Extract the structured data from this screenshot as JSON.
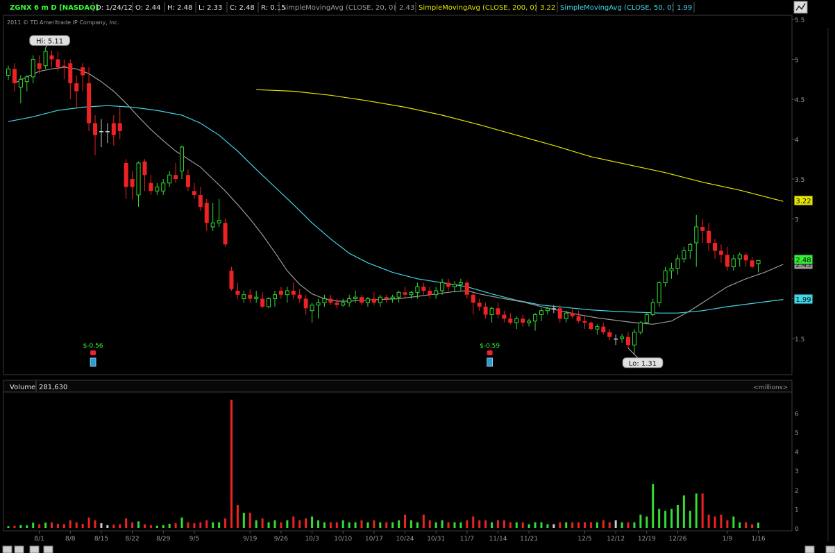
{
  "header": {
    "symbol": "ZGNX 6 m D [NASDAQ]",
    "d_label": "D: 1/24/12",
    "o_label": "O: 2.44",
    "h_label": "H: 2.48",
    "l_label": "L: 2.33",
    "c_label": "C: 2.48",
    "r_label": "R: 0.15",
    "studies": [
      {
        "label": "SimpleMovingAvg (CLOSE, 20, 0)",
        "value": "2.43",
        "color": "#9a9a9a"
      },
      {
        "label": "SimpleMovingAvg (CLOSE, 200, 0)",
        "value": "3.22",
        "color": "#e6e600"
      },
      {
        "label": "SimpleMovingAvg (CLOSE, 50, 0)",
        "value": "1.99",
        "color": "#40d8e8"
      }
    ]
  },
  "copyright": "2011 © TD Ameritrade IP Company, Inc.",
  "volume_panel": {
    "label": "Volume",
    "value": "281,630",
    "units": "<millions>"
  },
  "annotations": {
    "hi": "Hi: 5.11",
    "lo": "Lo: 1.31",
    "dividends": [
      "$-0.56",
      "$-0.59"
    ]
  },
  "price_badges": {
    "sma200": "3.22",
    "last": "2.48",
    "sma50": "1.99",
    "hidden": "2.43"
  },
  "colors": {
    "up": "#33dd33",
    "down": "#ee2222",
    "unchanged": "#cccccc",
    "sma20": "#9a9a9a",
    "sma200": "#e6e600",
    "sma50": "#40d8e8",
    "label_green": "#33ff33",
    "frame": "#3a3a3a"
  },
  "chart_data": {
    "type": "candlestick",
    "price_ylim": [
      1.0,
      5.5
    ],
    "price_ticks": [
      "5.5",
      "5",
      "4.5",
      "4",
      "3.5",
      "3",
      "2.5",
      "2",
      "1.5"
    ],
    "volume_ylim": [
      0,
      7
    ],
    "volume_ticks": [
      "6",
      "5",
      "4",
      "3",
      "2",
      "1",
      "0"
    ],
    "x_tick_labels": [
      "8/1",
      "8/8",
      "8/15",
      "8/22",
      "8/29",
      "9/5",
      "9/19",
      "9/26",
      "10/3",
      "10/10",
      "10/17",
      "10/24",
      "10/31",
      "11/7",
      "11/14",
      "11/21",
      "12/5",
      "12/12",
      "12/19",
      "12/26",
      "1/9",
      "1/16"
    ],
    "x_tick_index": [
      5,
      10,
      15,
      20,
      25,
      30,
      39,
      44,
      49,
      54,
      59,
      64,
      69,
      74,
      79,
      84,
      93,
      98,
      103,
      108,
      116,
      121
    ],
    "candles": [
      [
        4.8,
        4.92,
        4.74,
        4.88,
        0.1
      ],
      [
        4.88,
        4.95,
        4.6,
        4.7,
        0.12
      ],
      [
        4.65,
        4.8,
        4.45,
        4.75,
        0.15
      ],
      [
        4.72,
        4.8,
        4.6,
        4.78,
        0.14
      ],
      [
        4.78,
        5.05,
        4.7,
        5.0,
        0.28
      ],
      [
        4.95,
        5.05,
        4.82,
        4.88,
        0.2
      ],
      [
        4.92,
        5.14,
        4.88,
        5.1,
        0.28
      ],
      [
        5.05,
        5.11,
        4.9,
        5.0,
        0.3
      ],
      [
        5.0,
        5.1,
        4.85,
        4.9,
        0.22
      ],
      [
        4.92,
        5.0,
        4.75,
        4.9,
        0.2
      ],
      [
        4.95,
        5.0,
        4.5,
        4.7,
        0.4
      ],
      [
        4.7,
        4.8,
        4.4,
        4.6,
        0.3
      ],
      [
        4.9,
        4.95,
        4.6,
        4.8,
        0.22
      ],
      [
        4.7,
        4.9,
        4.1,
        4.2,
        0.55
      ],
      [
        4.2,
        4.3,
        3.8,
        4.05,
        0.4
      ],
      [
        4.1,
        4.25,
        3.9,
        4.1,
        0.25
      ],
      [
        4.1,
        4.2,
        3.95,
        4.1,
        0.15
      ],
      [
        4.2,
        4.3,
        3.92,
        4.05,
        0.18
      ],
      [
        4.2,
        4.4,
        4.0,
        4.1,
        0.2
      ],
      [
        3.7,
        3.75,
        3.25,
        3.4,
        0.5
      ],
      [
        3.5,
        3.6,
        3.25,
        3.4,
        0.3
      ],
      [
        3.3,
        3.72,
        3.15,
        3.7,
        0.35
      ],
      [
        3.72,
        3.75,
        3.35,
        3.55,
        0.2
      ],
      [
        3.45,
        3.55,
        3.3,
        3.35,
        0.15
      ],
      [
        3.35,
        3.45,
        3.3,
        3.4,
        0.12
      ],
      [
        3.35,
        3.5,
        3.3,
        3.45,
        0.15
      ],
      [
        3.45,
        3.6,
        3.4,
        3.55,
        0.22
      ],
      [
        3.55,
        3.7,
        3.45,
        3.5,
        0.25
      ],
      [
        3.6,
        3.92,
        3.5,
        3.9,
        0.55
      ],
      [
        3.55,
        3.62,
        3.35,
        3.4,
        0.3
      ],
      [
        3.35,
        3.45,
        3.25,
        3.3,
        0.25
      ],
      [
        3.3,
        3.4,
        3.1,
        3.15,
        0.3
      ],
      [
        3.2,
        3.25,
        2.85,
        2.95,
        0.4
      ],
      [
        2.9,
        3.2,
        2.85,
        2.95,
        0.3
      ],
      [
        2.95,
        3.25,
        2.9,
        2.98,
        0.3
      ],
      [
        2.95,
        3.0,
        2.65,
        2.68,
        0.5
      ],
      [
        2.35,
        2.4,
        2.1,
        2.12,
        6.7
      ],
      [
        2.1,
        2.2,
        2.0,
        2.05,
        1.2
      ],
      [
        2.0,
        2.1,
        1.95,
        2.05,
        0.8
      ],
      [
        2.05,
        2.12,
        1.95,
        2.0,
        0.8
      ],
      [
        2.0,
        2.1,
        1.95,
        2.02,
        0.4
      ],
      [
        2.0,
        2.08,
        1.88,
        1.9,
        0.5
      ],
      [
        1.9,
        2.02,
        1.88,
        2.0,
        0.3
      ],
      [
        2.0,
        2.1,
        1.9,
        2.05,
        0.4
      ],
      [
        2.1,
        2.15,
        2.0,
        2.05,
        0.3
      ],
      [
        2.05,
        2.15,
        1.95,
        2.1,
        0.4
      ],
      [
        2.1,
        2.2,
        2.0,
        2.05,
        0.6
      ],
      [
        2.05,
        2.12,
        1.95,
        2.0,
        0.4
      ],
      [
        2.0,
        2.05,
        1.8,
        1.88,
        0.5
      ],
      [
        1.85,
        1.95,
        1.7,
        1.92,
        0.6
      ],
      [
        1.92,
        2.0,
        1.75,
        1.95,
        0.4
      ],
      [
        1.95,
        2.05,
        1.9,
        2.0,
        0.3
      ],
      [
        2.0,
        2.05,
        1.92,
        1.95,
        0.3
      ],
      [
        1.95,
        2.0,
        1.88,
        1.92,
        0.3
      ],
      [
        1.92,
        2.0,
        1.9,
        1.95,
        0.4
      ],
      [
        1.95,
        2.05,
        1.9,
        2.0,
        0.3
      ],
      [
        2.0,
        2.1,
        1.95,
        2.02,
        0.3
      ],
      [
        2.02,
        2.05,
        1.92,
        1.95,
        0.4
      ],
      [
        1.95,
        2.02,
        1.9,
        2.0,
        0.3
      ],
      [
        2.0,
        2.08,
        1.92,
        1.95,
        0.4
      ],
      [
        1.95,
        2.05,
        1.9,
        2.02,
        0.3
      ],
      [
        2.02,
        2.05,
        1.95,
        2.0,
        0.3
      ],
      [
        2.0,
        2.05,
        1.95,
        2.02,
        0.3
      ],
      [
        2.02,
        2.1,
        1.95,
        2.08,
        0.4
      ],
      [
        2.08,
        2.15,
        2.0,
        2.05,
        0.7
      ],
      [
        2.05,
        2.1,
        2.0,
        2.08,
        0.4
      ],
      [
        2.08,
        2.2,
        2.0,
        2.15,
        0.3
      ],
      [
        2.15,
        2.2,
        2.05,
        2.1,
        0.7
      ],
      [
        2.1,
        2.15,
        2.0,
        2.05,
        0.4
      ],
      [
        2.05,
        2.15,
        2.0,
        2.1,
        0.3
      ],
      [
        2.1,
        2.25,
        2.05,
        2.2,
        0.4
      ],
      [
        2.2,
        2.25,
        2.1,
        2.15,
        0.3
      ],
      [
        2.15,
        2.22,
        2.08,
        2.18,
        0.3
      ],
      [
        2.18,
        2.25,
        2.1,
        2.2,
        0.3
      ],
      [
        2.2,
        2.22,
        2.0,
        2.05,
        0.4
      ],
      [
        2.05,
        2.1,
        1.8,
        1.95,
        0.6
      ],
      [
        1.95,
        2.0,
        1.85,
        1.9,
        0.4
      ],
      [
        1.9,
        1.95,
        1.75,
        1.8,
        0.4
      ],
      [
        1.8,
        1.9,
        1.7,
        1.88,
        0.3
      ],
      [
        1.88,
        1.95,
        1.75,
        1.8,
        0.4
      ],
      [
        1.8,
        1.85,
        1.7,
        1.75,
        0.4
      ],
      [
        1.75,
        1.82,
        1.68,
        1.7,
        0.3
      ],
      [
        1.7,
        1.78,
        1.62,
        1.75,
        0.3
      ],
      [
        1.75,
        1.8,
        1.65,
        1.7,
        0.3
      ],
      [
        1.7,
        1.75,
        1.65,
        1.72,
        0.2
      ],
      [
        1.72,
        1.82,
        1.6,
        1.8,
        0.3
      ],
      [
        1.8,
        1.88,
        1.72,
        1.85,
        0.3
      ],
      [
        1.85,
        1.9,
        1.8,
        1.88,
        0.2
      ],
      [
        1.88,
        1.92,
        1.82,
        1.88,
        0.2
      ],
      [
        1.88,
        1.92,
        1.7,
        1.75,
        0.3
      ],
      [
        1.75,
        1.85,
        1.7,
        1.82,
        0.3
      ],
      [
        1.82,
        1.88,
        1.75,
        1.78,
        0.3
      ],
      [
        1.78,
        1.85,
        1.7,
        1.72,
        0.3
      ],
      [
        1.72,
        1.78,
        1.62,
        1.7,
        0.3
      ],
      [
        1.7,
        1.72,
        1.6,
        1.62,
        0.3
      ],
      [
        1.62,
        1.68,
        1.55,
        1.65,
        0.3
      ],
      [
        1.65,
        1.7,
        1.55,
        1.58,
        0.4
      ],
      [
        1.58,
        1.62,
        1.48,
        1.52,
        0.3
      ],
      [
        1.5,
        1.55,
        1.42,
        1.5,
        0.4
      ],
      [
        1.5,
        1.56,
        1.45,
        1.52,
        0.3
      ],
      [
        1.52,
        1.58,
        1.38,
        1.42,
        0.3
      ],
      [
        1.42,
        1.62,
        1.31,
        1.58,
        0.3
      ],
      [
        1.58,
        1.72,
        1.55,
        1.7,
        0.7
      ],
      [
        1.7,
        1.82,
        1.68,
        1.8,
        0.6
      ],
      [
        1.8,
        2.0,
        1.78,
        1.95,
        2.3
      ],
      [
        1.95,
        2.22,
        1.9,
        2.2,
        1.0
      ],
      [
        2.2,
        2.4,
        2.15,
        2.35,
        0.9
      ],
      [
        2.35,
        2.45,
        2.25,
        2.38,
        1.0
      ],
      [
        2.38,
        2.55,
        2.3,
        2.5,
        1.2
      ],
      [
        2.5,
        2.65,
        2.45,
        2.6,
        1.7
      ],
      [
        2.6,
        2.7,
        2.5,
        2.68,
        0.9
      ],
      [
        2.7,
        3.05,
        2.4,
        2.9,
        1.8
      ],
      [
        2.9,
        3.0,
        2.7,
        2.85,
        1.8
      ],
      [
        2.85,
        2.95,
        2.6,
        2.7,
        0.7
      ],
      [
        2.7,
        2.75,
        2.5,
        2.6,
        0.6
      ],
      [
        2.6,
        2.68,
        2.45,
        2.55,
        0.7
      ],
      [
        2.55,
        2.65,
        2.35,
        2.4,
        0.4
      ],
      [
        2.4,
        2.55,
        2.35,
        2.5,
        0.6
      ],
      [
        2.5,
        2.58,
        2.4,
        2.55,
        0.3
      ],
      [
        2.55,
        2.58,
        2.4,
        2.48,
        0.3
      ],
      [
        2.48,
        2.52,
        2.38,
        2.4,
        0.2
      ],
      [
        2.44,
        2.48,
        2.33,
        2.48,
        0.28
      ]
    ],
    "sma20": [
      [
        1,
        4.7
      ],
      [
        3,
        4.78
      ],
      [
        5,
        4.85
      ],
      [
        7,
        4.88
      ],
      [
        9,
        4.9
      ],
      [
        11,
        4.88
      ],
      [
        13,
        4.82
      ],
      [
        15,
        4.72
      ],
      [
        17,
        4.6
      ],
      [
        19,
        4.45
      ],
      [
        21,
        4.28
      ],
      [
        23,
        4.12
      ],
      [
        25,
        3.98
      ],
      [
        27,
        3.85
      ],
      [
        29,
        3.75
      ],
      [
        31,
        3.65
      ],
      [
        33,
        3.5
      ],
      [
        35,
        3.35
      ],
      [
        37,
        3.18
      ],
      [
        39,
        3.0
      ],
      [
        41,
        2.8
      ],
      [
        43,
        2.58
      ],
      [
        45,
        2.35
      ],
      [
        47,
        2.18
      ],
      [
        49,
        2.06
      ],
      [
        51,
        2.0
      ],
      [
        53,
        1.97
      ],
      [
        55,
        1.97
      ],
      [
        57,
        1.98
      ],
      [
        60,
        1.99
      ],
      [
        63,
        2.0
      ],
      [
        66,
        2.03
      ],
      [
        69,
        2.06
      ],
      [
        72,
        2.09
      ],
      [
        74,
        2.1
      ],
      [
        76,
        2.06
      ],
      [
        78,
        2.03
      ],
      [
        80,
        2.0
      ],
      [
        83,
        1.96
      ],
      [
        86,
        1.9
      ],
      [
        89,
        1.85
      ],
      [
        92,
        1.8
      ],
      [
        95,
        1.76
      ],
      [
        98,
        1.73
      ],
      [
        101,
        1.7
      ],
      [
        104,
        1.68
      ],
      [
        107,
        1.72
      ],
      [
        110,
        1.85
      ],
      [
        113,
        2.0
      ],
      [
        116,
        2.15
      ],
      [
        119,
        2.25
      ],
      [
        122,
        2.33
      ],
      [
        125,
        2.43
      ]
    ],
    "sma50": [
      [
        0,
        4.22
      ],
      [
        4,
        4.28
      ],
      [
        8,
        4.36
      ],
      [
        12,
        4.4
      ],
      [
        16,
        4.42
      ],
      [
        20,
        4.4
      ],
      [
        24,
        4.36
      ],
      [
        28,
        4.3
      ],
      [
        31,
        4.2
      ],
      [
        34,
        4.05
      ],
      [
        37,
        3.85
      ],
      [
        40,
        3.62
      ],
      [
        43,
        3.4
      ],
      [
        46,
        3.18
      ],
      [
        49,
        2.95
      ],
      [
        52,
        2.75
      ],
      [
        55,
        2.57
      ],
      [
        58,
        2.45
      ],
      [
        62,
        2.33
      ],
      [
        66,
        2.25
      ],
      [
        70,
        2.2
      ],
      [
        74,
        2.15
      ],
      [
        78,
        2.06
      ],
      [
        82,
        1.98
      ],
      [
        86,
        1.92
      ],
      [
        90,
        1.89
      ],
      [
        94,
        1.86
      ],
      [
        98,
        1.84
      ],
      [
        102,
        1.83
      ],
      [
        105,
        1.82
      ],
      [
        108,
        1.82
      ],
      [
        112,
        1.85
      ],
      [
        116,
        1.9
      ],
      [
        120,
        1.94
      ],
      [
        125,
        1.99
      ]
    ],
    "sma200": [
      [
        40,
        4.62
      ],
      [
        46,
        4.6
      ],
      [
        52,
        4.55
      ],
      [
        58,
        4.48
      ],
      [
        64,
        4.4
      ],
      [
        70,
        4.3
      ],
      [
        76,
        4.18
      ],
      [
        82,
        4.05
      ],
      [
        88,
        3.92
      ],
      [
        94,
        3.78
      ],
      [
        100,
        3.68
      ],
      [
        106,
        3.58
      ],
      [
        112,
        3.46
      ],
      [
        118,
        3.36
      ],
      [
        125,
        3.22
      ]
    ],
    "hi_index": 6,
    "lo_index": 100,
    "dividend_index": [
      13,
      77
    ]
  }
}
